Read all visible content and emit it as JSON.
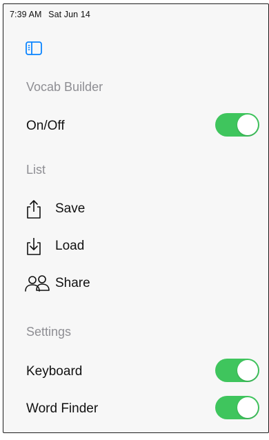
{
  "status_bar": {
    "time": "7:39 AM",
    "date": "Sat Jun 14"
  },
  "icons": {
    "sidebar_toggle": "sidebar-icon",
    "save": "share-up-icon",
    "load": "download-tray-icon",
    "share": "people-icon"
  },
  "colors": {
    "accent_blue": "#0a84ff",
    "toggle_green": "#3fc55d",
    "section_gray": "#8e8e93"
  },
  "vocab_builder": {
    "header": "Vocab Builder",
    "on_off_label": "On/Off",
    "on_off_state": true
  },
  "list": {
    "header": "List",
    "items": [
      {
        "label": "Save"
      },
      {
        "label": "Load"
      },
      {
        "label": "Share"
      }
    ]
  },
  "settings": {
    "header": "Settings",
    "keyboard_label": "Keyboard",
    "keyboard_state": true,
    "word_finder_label": "Word Finder",
    "word_finder_state": true
  }
}
